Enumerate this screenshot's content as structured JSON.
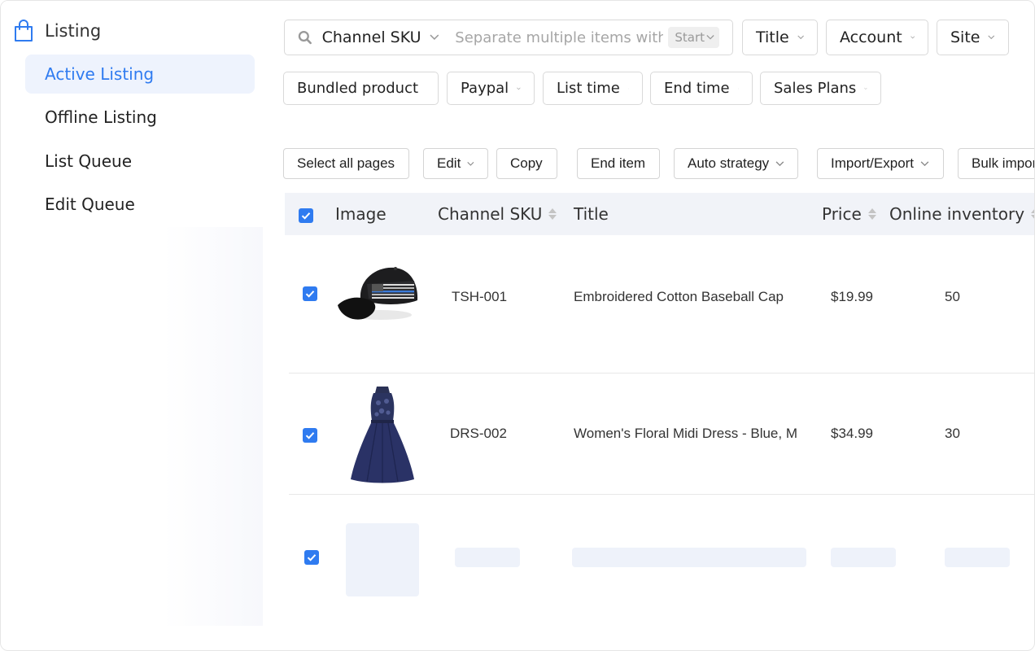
{
  "sidebar": {
    "title": "Listing",
    "items": [
      {
        "label": "Active Listing",
        "active": true
      },
      {
        "label": "Offline Listing",
        "active": false
      },
      {
        "label": "List Queue",
        "active": false
      },
      {
        "label": "Edit Queue",
        "active": false
      }
    ]
  },
  "filters": {
    "search_field": "Channel SKU",
    "search_placeholder": "Separate multiple items with",
    "search_mode": "Start",
    "dropdowns": [
      "Title",
      "Account",
      "Site",
      "Bundled product",
      "Paypal",
      "List time",
      "End time",
      "Sales Plans"
    ]
  },
  "actions": {
    "select_all": "Select all pages",
    "edit": "Edit",
    "copy": "Copy",
    "end_item": "End item",
    "auto_strategy": "Auto strategy",
    "import_export": "Import/Export",
    "bulk_import": "Bulk impor"
  },
  "table": {
    "headers": {
      "image": "Image",
      "sku": "Channel SKU",
      "title": "Title",
      "price": "Price",
      "inventory": "Online inventory"
    },
    "rows": [
      {
        "sku": "TSH-001",
        "title": "Embroidered Cotton Baseball Cap",
        "price": "$19.99",
        "inventory": "50",
        "image": "baseball-cap"
      },
      {
        "sku": "DRS-002",
        "title": "Women's Floral Midi Dress - Blue, M",
        "price": "$34.99",
        "inventory": "30",
        "image": "midi-dress"
      }
    ]
  },
  "colors": {
    "accent": "#2f7bf0",
    "header_bg": "#f1f3f8",
    "active_bg": "#eef3fd"
  }
}
